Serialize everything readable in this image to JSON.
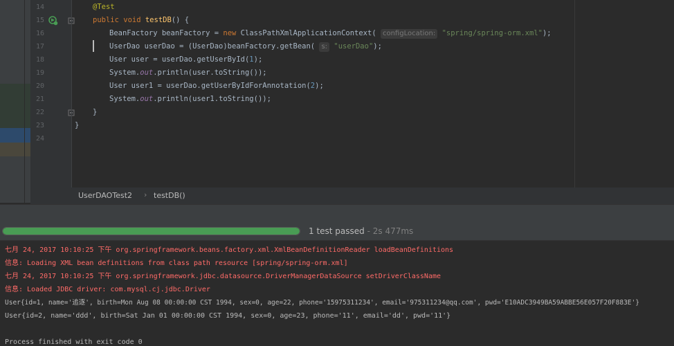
{
  "colors": {
    "pass_green": "#499c54",
    "log_red": "#ff6b68",
    "editor_bg": "#2b2b2b"
  },
  "editor": {
    "line_numbers": [
      "14",
      "15",
      "16",
      "17",
      "18",
      "19",
      "20",
      "21",
      "22",
      "23",
      "24"
    ],
    "lines": {
      "l14": {
        "annotation": "@Test"
      },
      "l15": {
        "kw": "public void ",
        "method": "testDB",
        "rest": "() {"
      },
      "l16": {
        "a": "BeanFactory beanFactory = ",
        "kw": "new ",
        "b": "ClassPathXmlApplicationContext(",
        "hint": "configLocation:",
        "str": "\"spring/spring-orm.xml\"",
        "c": ");"
      },
      "l17": {
        "a": "UserDao userDao = (UserDao)beanFactory.getBean(",
        "hint": "s:",
        "str": "\"userDao\"",
        "c": ");"
      },
      "l18": {
        "a": "User user = userDao.getUserById(",
        "num": "1",
        "c": ");"
      },
      "l19": {
        "a": "System.",
        "field": "out",
        "b": ".println(user.toString());"
      },
      "l20": {
        "a": "User user1 = userDao.getUserByIdForAnnotation(",
        "num": "2",
        "c": ");"
      },
      "l21": {
        "a": "System.",
        "field": "out",
        "b": ".println(user1.toString());"
      },
      "l22": "}",
      "l23": "}",
      "l24": ""
    },
    "icons": {
      "run": "run-test-icon",
      "fold": "fold-icon"
    }
  },
  "breadcrumb": {
    "class_name": "UserDAOTest2",
    "method_name": "testDB()"
  },
  "run": {
    "progress_percent": 100,
    "status": "1 test passed",
    "time": " - 2s 477ms"
  },
  "console": {
    "lines": [
      "七月 24, 2017 10:10:25 下午 org.springframework.beans.factory.xml.XmlBeanDefinitionReader loadBeanDefinitions",
      "信息: Loading XML bean definitions from class path resource [spring/spring-orm.xml]",
      "七月 24, 2017 10:10:25 下午 org.springframework.jdbc.datasource.DriverManagerDataSource setDriverClassName",
      "信息: Loaded JDBC driver: com.mysql.cj.jdbc.Driver",
      "User{id=1, name='追逐', birth=Mon Aug 08 00:00:00 CST 1994, sex=0, age=22, phone='15975311234', email='975311234@qq.com', pwd='E10ADC3949BA59ABBE56E057F20F883E'}",
      "User{id=2, name='ddd', birth=Sat Jan 01 00:00:00 CST 1994, sex=0, age=23, phone='11', email='dd', pwd='11'}",
      "",
      "Process finished with exit code 0"
    ]
  }
}
